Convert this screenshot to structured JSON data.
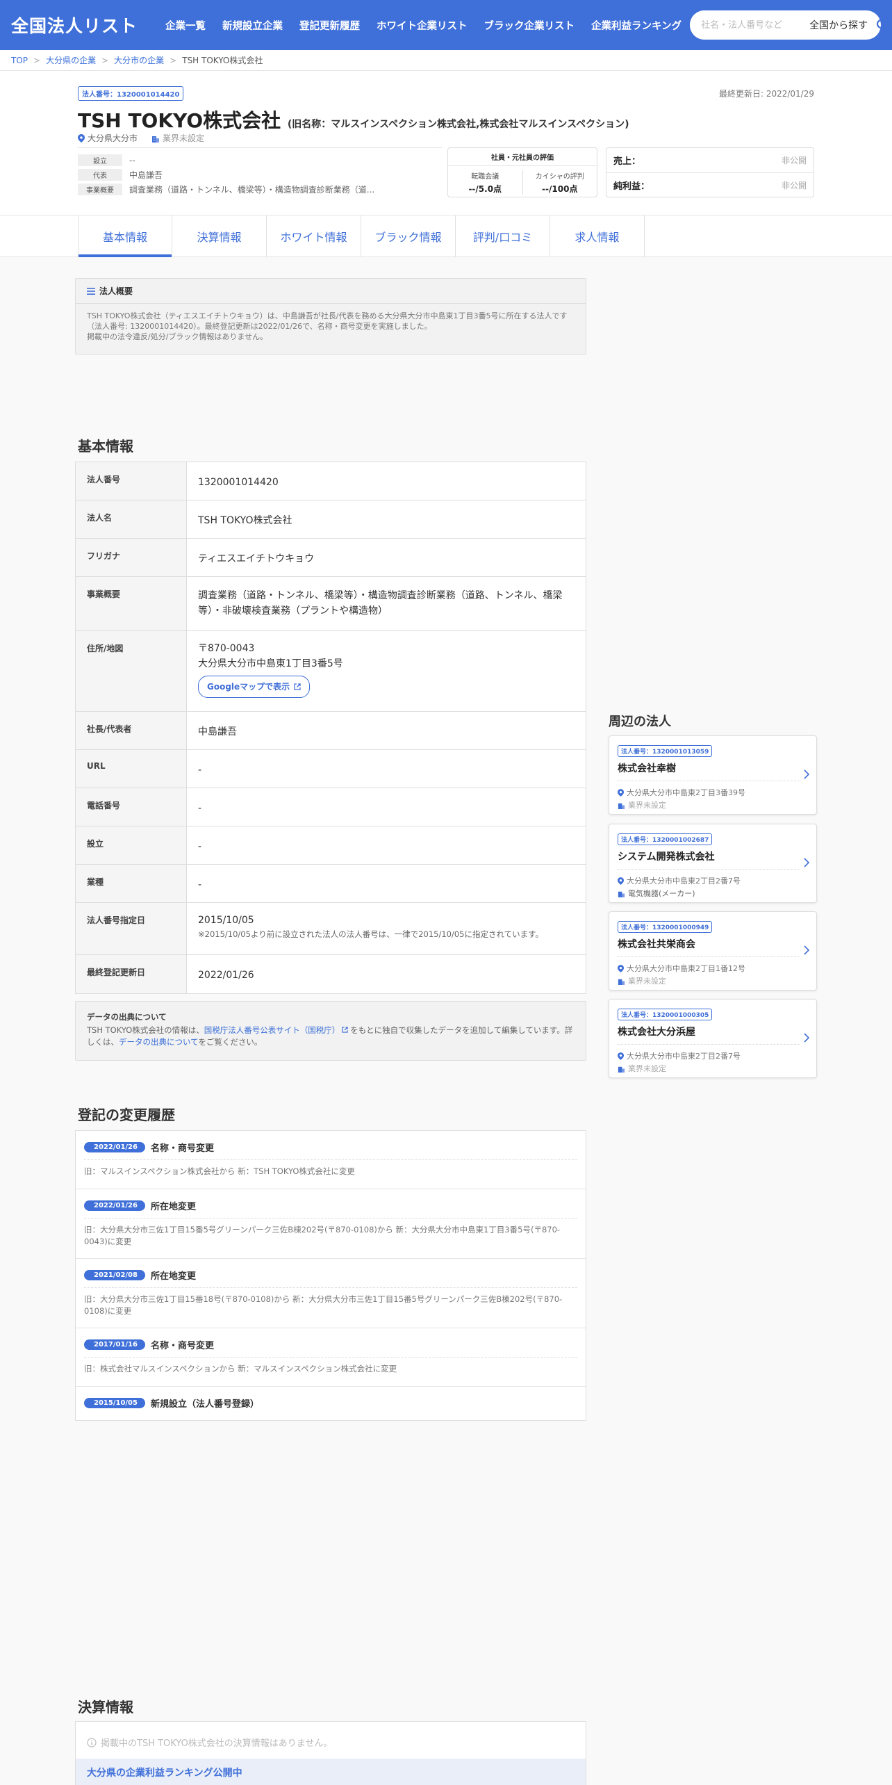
{
  "header": {
    "logo": "全国法人リスト",
    "nav": [
      "企業一覧",
      "新規設立企業",
      "登記更新履歴",
      "ホワイト企業リスト",
      "ブラック企業リスト",
      "企業利益ランキング"
    ],
    "search_placeholder": "社名・法人番号など",
    "search_region": "全国から探す",
    "search_icon": "search-icon"
  },
  "breadcrumb": [
    "TOP",
    "大分県の企業",
    "大分市の企業",
    "TSH TOKYO株式会社"
  ],
  "company": {
    "corp_number_badge": "法人番号：1320001014420",
    "last_updated": "最終更新日: 2022/01/29",
    "name": "TSH TOKYO株式会社",
    "old_name": "(旧名称：マルスインスペクション株式会社,株式会社マルスインスペクション)",
    "location": "大分県大分市",
    "industry": "業界未設定",
    "summary": [
      {
        "label": "設立",
        "value": "--"
      },
      {
        "label": "代表",
        "value": "中島謙吾"
      },
      {
        "label": "事業概要",
        "value": "調査業務（道路・トンネル、橋梁等）・構造物調査診断業務（道..."
      }
    ],
    "rating": {
      "title": "社員・元社員の評価",
      "items": [
        {
          "label": "転職会議",
          "value": "--/5.0点"
        },
        {
          "label": "カイシャの評判",
          "value": "--/100点"
        }
      ]
    },
    "money": [
      {
        "label": "売上：",
        "value": "非公開"
      },
      {
        "label": "純利益：",
        "value": "非公開"
      }
    ]
  },
  "tabs": [
    "基本情報",
    "決算情報",
    "ホワイト情報",
    "ブラック情報",
    "評判/口コミ",
    "求人情報"
  ],
  "overview": {
    "title": "法人概要",
    "text1": "TSH TOKYO株式会社（ティエスエイチトウキョウ）は、中島謙吾が社長/代表を務める大分県大分市中島東1丁目3番5号に所在する法人です",
    "text2": "（法人番号: 1320001014420）。最終登記更新は2022/01/26で、名称・商号変更を実施しました。",
    "text3": "掲載中の法令違反/処分/ブラック情報はありません。"
  },
  "basic_info": {
    "title": "基本情報",
    "rows": [
      {
        "key": "法人番号",
        "value": "1320001014420"
      },
      {
        "key": "法人名",
        "value": "TSH TOKYO株式会社"
      },
      {
        "key": "フリガナ",
        "value": "ティエスエイチトウキョウ"
      },
      {
        "key": "事業概要",
        "value": "調査業務（道路・トンネル、橋梁等）・構造物調査診断業務（道路、トンネル、橋梁等）・非破壊検査業務（プラントや構造物）"
      },
      {
        "key": "住所/地図",
        "value": "〒870-0043",
        "value2": "大分県大分市中島東1丁目3番5号",
        "button": "Googleマップで表示"
      },
      {
        "key": "社長/代表者",
        "value": "中島謙吾"
      },
      {
        "key": "URL",
        "value": "-"
      },
      {
        "key": "電話番号",
        "value": "-"
      },
      {
        "key": "設立",
        "value": "-"
      },
      {
        "key": "業種",
        "value": "-"
      },
      {
        "key": "法人番号指定日",
        "value": "2015/10/05",
        "note": "※2015/10/05より前に設立された法人の法人番号は、一律で2015/10/05に指定されています。"
      },
      {
        "key": "最終登記更新日",
        "value": "2022/01/26"
      }
    ]
  },
  "source": {
    "title": "データの出典について",
    "text_a": "TSH TOKYO株式会社の情報は、",
    "link1": "国税庁法人番号公表サイト（国税庁）",
    "text_b": "をもとに独自で収集したデータを追加して編集しています。詳しくは、",
    "link2": "データの出典について",
    "text_c": "をご覧ください。"
  },
  "history": {
    "title": "登記の変更履歴",
    "items": [
      {
        "date": "2022/01/26",
        "type": "名称・商号変更",
        "detail": "旧：マルスインスペクション株式会社から 新：TSH TOKYO株式会社に変更"
      },
      {
        "date": "2022/01/26",
        "type": "所在地変更",
        "detail": "旧：大分県大分市三佐1丁目15番5号グリーンパーク三佐B棟202号(〒870-0108)から 新：大分県大分市中島東1丁目3番5号(〒870-0043)に変更"
      },
      {
        "date": "2021/02/08",
        "type": "所在地変更",
        "detail": "旧：大分県大分市三佐1丁目15番18号(〒870-0108)から 新：大分県大分市三佐1丁目15番5号グリーンパーク三佐B棟202号(〒870-0108)に変更"
      },
      {
        "date": "2017/01/16",
        "type": "名称・商号変更",
        "detail": "旧：株式会社マルスインスペクションから 新：マルスインスペクション株式会社に変更"
      },
      {
        "date": "2015/10/05",
        "type": "新規設立（法人番号登録）",
        "detail": ""
      }
    ]
  },
  "finance": {
    "title": "決算情報",
    "message": "掲載中のTSH TOKYO株式会社の決算情報はありません。",
    "ranking_link": "大分県の企業利益ランキング公開中"
  },
  "nearby": {
    "title": "周辺の法人",
    "items": [
      {
        "badge": "法人番号：1320001013059",
        "name": "株式会社幸樹",
        "address": "大分県大分市中島東2丁目3番39号",
        "industry": "業界未設定"
      },
      {
        "badge": "法人番号：1320001002687",
        "name": "システム開発株式会社",
        "address": "大分県大分市中島東2丁目2番7号",
        "industry": "電気機器(メーカー)"
      },
      {
        "badge": "法人番号：1320001000949",
        "name": "株式会社共栄商会",
        "address": "大分県大分市中島東2丁目1番12号",
        "industry": "業界未設定"
      },
      {
        "badge": "法人番号：1320001000305",
        "name": "株式会社大分浜屋",
        "address": "大分県大分市中島東2丁目2番7号",
        "industry": "業界未設定"
      }
    ]
  },
  "colors": {
    "brand": "#3f6fd8",
    "background": "#f9f9f9"
  }
}
